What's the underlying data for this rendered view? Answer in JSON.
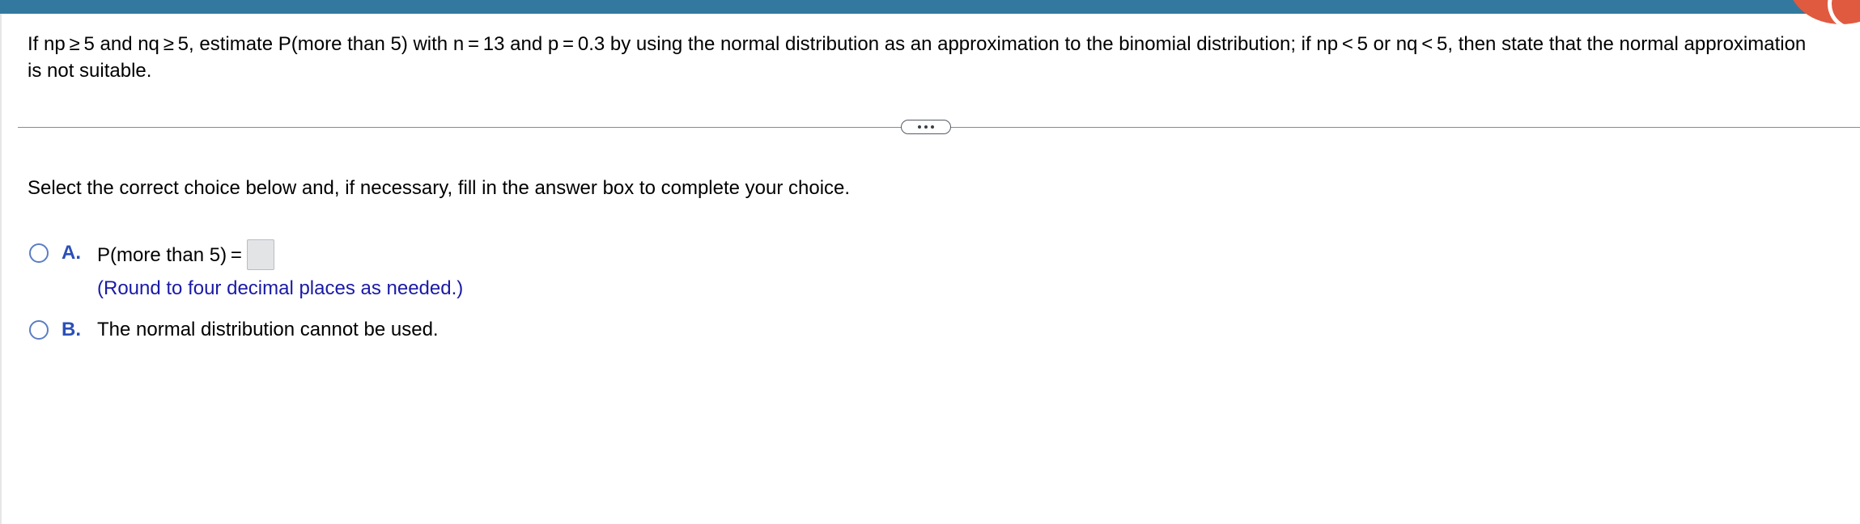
{
  "header": {
    "bar_color": "#33799f",
    "badge_color": "#e05a3f"
  },
  "question": {
    "text": "If np ≥ 5 and nq ≥ 5, estimate P(more than 5) with n = 13 and p = 0.3 by using the normal distribution as an approximation to the binomial distribution; if np < 5 or nq < 5, then state that the normal approximation is not suitable."
  },
  "divider": {
    "expand_icon": "ellipsis-icon"
  },
  "instruction": "Select the correct choice below and, if necessary, fill in the answer box to complete your choice.",
  "choices": [
    {
      "letter": "A.",
      "label": "P(more than 5) =",
      "answer_value": "",
      "hint": "(Round to four decimal places as needed.)"
    },
    {
      "letter": "B.",
      "label": "The normal distribution cannot be used."
    }
  ]
}
